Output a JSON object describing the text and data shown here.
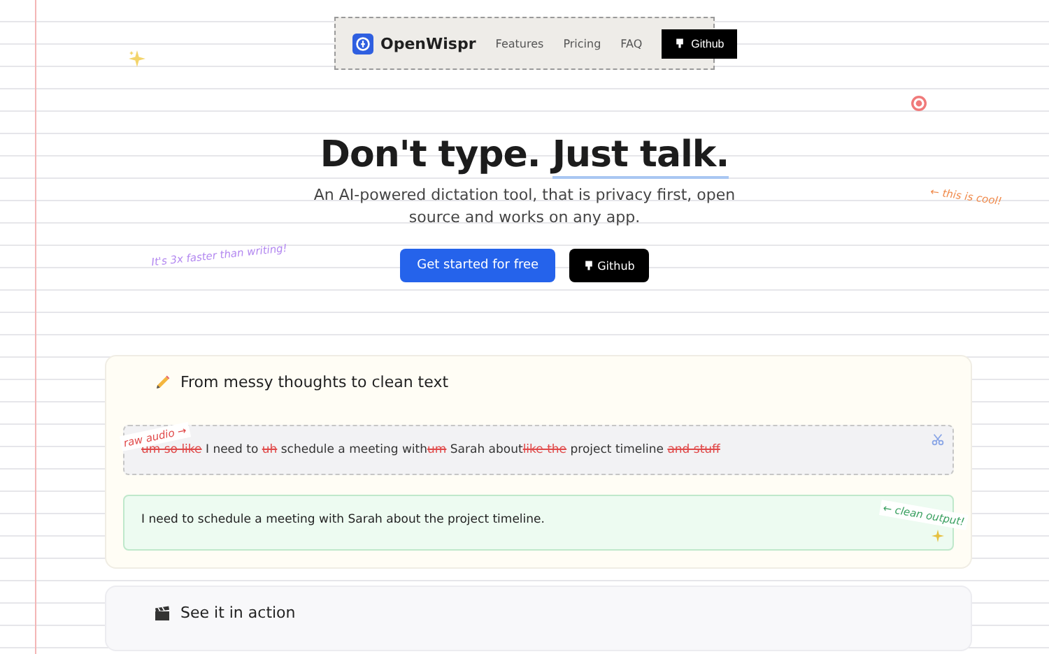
{
  "nav": {
    "brand": "OpenWispr",
    "links": [
      "Features",
      "Pricing",
      "FAQ"
    ],
    "github": "Github"
  },
  "hero": {
    "title_start": "Don't type.",
    "title_highlight": "Just talk.",
    "subtitle": "An AI-powered dictation tool, that is privacy first, open source and works on any app.",
    "primary_button": "Get started for free",
    "secondary_button": "Github"
  },
  "notes": [
    {
      "text": "It's 3x faster than writing!",
      "color": "#b388f0",
      "kind": "left"
    },
    {
      "text": "← this is cool!",
      "color": "#f08a4b",
      "kind": "right"
    }
  ],
  "demo": {
    "title": "From messy thoughts to clean text",
    "raw_note": "raw audio →",
    "raw": [
      {
        "text": "um so like",
        "kind": "filler"
      },
      {
        "text": " I need to ",
        "kind": "word"
      },
      {
        "text": "uh",
        "kind": "filler"
      },
      {
        "text": " schedule a meeting with",
        "kind": "word"
      },
      {
        "text": "um",
        "kind": "filler"
      },
      {
        "text": " Sarah about",
        "kind": "word"
      },
      {
        "text": "like the",
        "kind": "filler"
      },
      {
        "text": " project timeline ",
        "kind": "word"
      },
      {
        "text": "and stuff",
        "kind": "filler"
      }
    ],
    "clean_note": "← clean output!",
    "clean": "I need to schedule a meeting with Sarah about the project timeline."
  },
  "next_section": {
    "title": "See it in action"
  }
}
